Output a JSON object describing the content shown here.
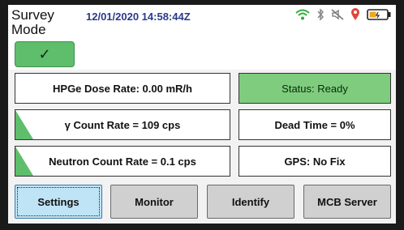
{
  "header": {
    "mode_title": "Survey Mode",
    "timestamp": "12/01/2020 14:58:44Z",
    "check_symbol": "✓",
    "check_color": "#5ebe6b"
  },
  "status_bar": {
    "icons": [
      "wifi-icon",
      "bluetooth-icon",
      "speaker-muted-icon",
      "location-pin-icon",
      "battery-icon"
    ]
  },
  "readouts": {
    "hpge_dose_rate": "HPGe Dose Rate: 0.00 mR/h",
    "gamma_count_rate": "γ Count Rate = 109 cps",
    "neutron_count_rate": "Neutron Count Rate = 0.1 cps",
    "status": "Status: Ready",
    "dead_time": "Dead Time = 0%",
    "gps": "GPS: No Fix"
  },
  "colors": {
    "status_ready": "#7fcc7f",
    "indicator_wedge": "#5ebe6b",
    "active_button": "#bfe4f6",
    "timestamp_text": "#2a3a8a"
  },
  "buttons": {
    "settings": "Settings",
    "monitor": "Monitor",
    "identify": "Identify",
    "mcb_server": "MCB Server"
  }
}
